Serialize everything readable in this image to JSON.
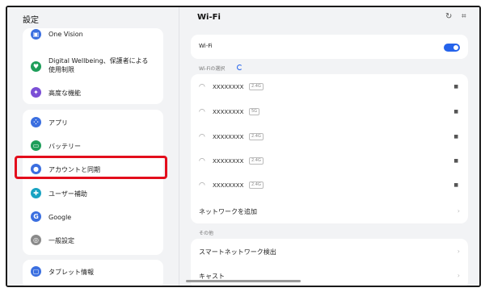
{
  "settings_title": "設定",
  "left": {
    "card1": [
      {
        "label": "One Vision",
        "icon": "one-vision-icon",
        "color": "#3b6fe0",
        "glyph": "▣"
      },
      {
        "label": "Digital Wellbeing、保護者による使用制限",
        "icon": "wellbeing-icon",
        "color": "#1e9e5a",
        "glyph": "♥"
      },
      {
        "label": "高度な機能",
        "icon": "advanced-features-icon",
        "color": "#7b4fd6",
        "glyph": "✦"
      }
    ],
    "card2": [
      {
        "label": "アプリ",
        "icon": "apps-icon",
        "color": "#3b6fe0",
        "glyph": "⁘"
      },
      {
        "label": "バッテリー",
        "icon": "battery-icon",
        "color": "#1e9e5a",
        "glyph": "▭"
      },
      {
        "label": "アカウントと同期",
        "icon": "account-sync-icon",
        "color": "#3b6fe0",
        "glyph": "●"
      },
      {
        "label": "ユーザー補助",
        "icon": "accessibility-icon",
        "color": "#19a3c2",
        "glyph": "✚"
      },
      {
        "label": "Google",
        "icon": "google-icon",
        "color": "#3b6fe0",
        "glyph": "G"
      },
      {
        "label": "一般設定",
        "icon": "general-settings-icon",
        "color": "#8a8a8a",
        "glyph": "◎"
      }
    ],
    "card3": [
      {
        "label": "タブレット情報",
        "icon": "tablet-info-icon",
        "color": "#3b6fe0",
        "glyph": "▢"
      }
    ]
  },
  "right": {
    "title": "Wi-Fi",
    "wifi_label": "Wi-Fi",
    "wifi_on": true,
    "section_select": "Wi-Fiの選択",
    "networks": [
      {
        "ssid": "XXXXXXXX",
        "band": "2.4G"
      },
      {
        "ssid": "XXXXXXXX",
        "band": "5G"
      },
      {
        "ssid": "XXXXXXXX",
        "band": "2.4G"
      },
      {
        "ssid": "XXXXXXXX",
        "band": "2.4G"
      },
      {
        "ssid": "XXXXXXXX",
        "band": "2.4G"
      }
    ],
    "add_network": "ネットワークを追加",
    "section_other": "その他",
    "other_items": [
      "スマートネットワーク検出",
      "キャスト"
    ],
    "accent_color": "#2563eb",
    "highlight_color": "#e30d1c"
  }
}
